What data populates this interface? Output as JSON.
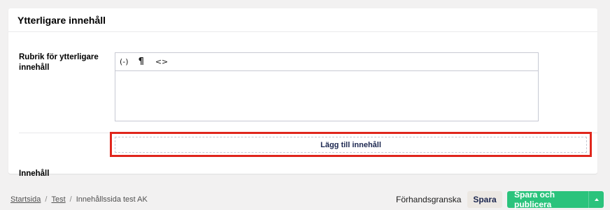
{
  "panel": {
    "title": "Ytterligare innehåll"
  },
  "fields": {
    "heading_label": "Rubrik för ytterligare innehåll",
    "content_label": "Innehåll"
  },
  "editor": {
    "toolbar": [
      {
        "name": "macro-icon",
        "glyph": "(-)"
      },
      {
        "name": "paragraph-icon",
        "glyph": "¶"
      },
      {
        "name": "code-icon",
        "glyph": "<>"
      }
    ],
    "value": ""
  },
  "add_content": {
    "label": "Lägg till innehåll"
  },
  "breadcrumb": {
    "items": [
      "Startsida",
      "Test",
      "Innehållssida test AK"
    ],
    "separator": "/"
  },
  "actions": {
    "preview_label": "Förhandsgranska",
    "save_label": "Spara",
    "publish_label": "Spara och publicera"
  },
  "colors": {
    "highlight": "#e0261c",
    "publish": "#2bc37c",
    "save_bg": "#ece8e3"
  }
}
